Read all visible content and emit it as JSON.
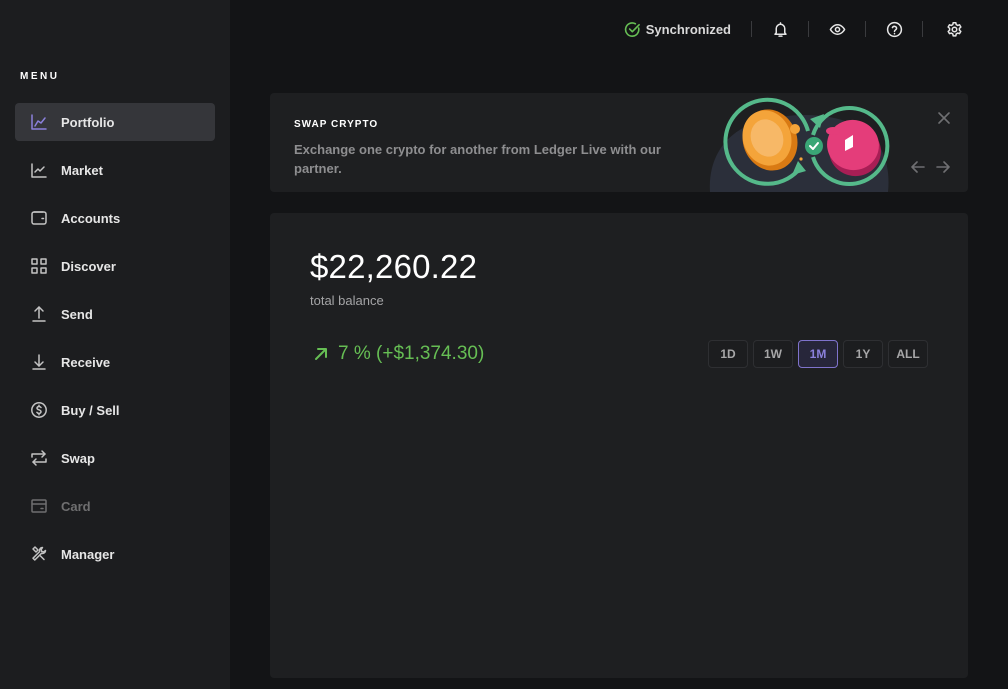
{
  "sidebar": {
    "menu_title": "MENU",
    "items": [
      {
        "label": "Portfolio",
        "icon": "chart-line-icon",
        "state": "active"
      },
      {
        "label": "Market",
        "icon": "market-chart-icon",
        "state": "normal"
      },
      {
        "label": "Accounts",
        "icon": "wallet-icon",
        "state": "normal"
      },
      {
        "label": "Discover",
        "icon": "grid-icon",
        "state": "normal"
      },
      {
        "label": "Send",
        "icon": "arrow-up-icon",
        "state": "normal"
      },
      {
        "label": "Receive",
        "icon": "arrow-down-icon",
        "state": "normal"
      },
      {
        "label": "Buy / Sell",
        "icon": "dollar-circle-icon",
        "state": "normal"
      },
      {
        "label": "Swap",
        "icon": "swap-arrows-icon",
        "state": "normal"
      },
      {
        "label": "Card",
        "icon": "card-icon",
        "state": "disabled"
      },
      {
        "label": "Manager",
        "icon": "tools-icon",
        "state": "normal"
      }
    ]
  },
  "topbar": {
    "sync_status": "Synchronized",
    "sync_color": "#66be54",
    "icons": [
      "bell-icon",
      "eye-icon",
      "help-icon",
      "settings-icon"
    ]
  },
  "banner": {
    "title": "SWAP CRYPTO",
    "description": "Exchange one crypto for another from Ledger Live with our partner."
  },
  "portfolio": {
    "balance": "$22,260.22",
    "balance_label": "total balance",
    "change": "7 % (+$1,374.30)",
    "change_color": "#66be54",
    "ranges": [
      {
        "label": "1D",
        "active": false
      },
      {
        "label": "1W",
        "active": false
      },
      {
        "label": "1M",
        "active": true
      },
      {
        "label": "1Y",
        "active": false
      },
      {
        "label": "ALL",
        "active": false
      }
    ],
    "accent": "#8b80db"
  }
}
